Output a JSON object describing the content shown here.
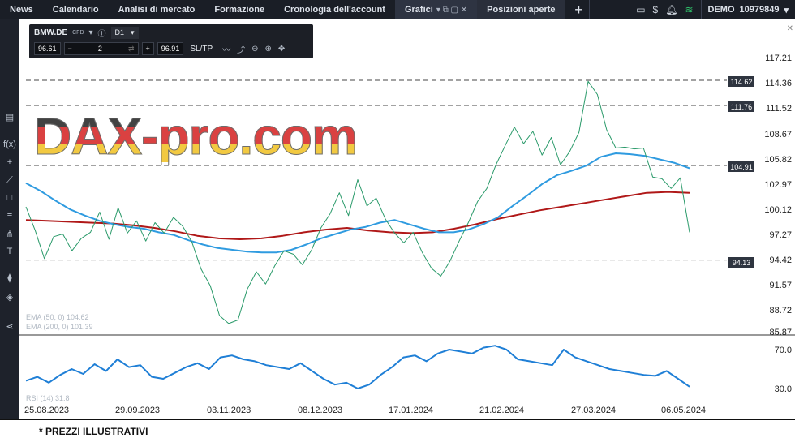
{
  "nav": {
    "tabs": [
      "News",
      "Calendario",
      "Analisi di mercato",
      "Formazione",
      "Cronologia dell'account"
    ],
    "active_tab": "Grafici",
    "active_tab_icons": "▾  ⧉ ▢ ✕",
    "positions_tab": "Posizioni aperte",
    "plus": "+",
    "account_type": "DEMO",
    "account_number": "10979849",
    "account_caret": "▾"
  },
  "sidebar_icons": [
    "layout-icon",
    "fx-icon",
    "crosshair-icon",
    "line-icon",
    "rectangle-icon",
    "fib-icon",
    "pitchfork-icon",
    "text-icon",
    "indicators-icon",
    "layers-icon",
    "share-icon"
  ],
  "widget": {
    "symbol": "BMW.DE",
    "cfd": "CFD",
    "timeframe": "D1",
    "bid": "96.61",
    "qty": "2",
    "ask": "96.91",
    "sltp": "SL/TP",
    "minus": "−",
    "plus": "+"
  },
  "watermark": "DAX-pro.com",
  "price_axis": [
    "117.21",
    "114.36",
    "111.52",
    "108.67",
    "105.82",
    "102.97",
    "100.12",
    "97.27",
    "94.42",
    "91.57",
    "88.72",
    "85.87"
  ],
  "level_tags": [
    "114.62",
    "111.76",
    "104.91",
    "94.13"
  ],
  "rsi_axis": [
    "70.0",
    "30.0"
  ],
  "dates": [
    "25.08.2023",
    "29.09.2023",
    "03.11.2023",
    "08.12.2023",
    "17.01.2024",
    "21.02.2024",
    "27.03.2024",
    "06.05.2024"
  ],
  "legend": {
    "ema50": "EMA (50, 0) 104.62",
    "ema200": "EMA (200, 0) 101.39",
    "rsi": "RSI (14) 31.8"
  },
  "footnote": "* PREZZI ILLUSTRATIVI",
  "colors": {
    "price": "#2a9a6a",
    "ema50": "#2f9be0",
    "ema200": "#b01818",
    "rsi": "#1f7fd6",
    "topbar": "#1a1e26"
  },
  "chart_data": {
    "type": "line",
    "price_close_approx": [
      100.2,
      97.5,
      94.3,
      96.8,
      97.1,
      95.2,
      96.6,
      97.3,
      99.6,
      96.5,
      100.1,
      97.2,
      98.6,
      96.3,
      98.4,
      97.2,
      99.0,
      98.0,
      96.2,
      93.1,
      91.2,
      87.8,
      86.9,
      87.3,
      90.8,
      92.8,
      91.4,
      93.5,
      95.2,
      94.8,
      93.6,
      95.3,
      97.8,
      99.4,
      101.8,
      99.2,
      103.3,
      100.3,
      101.2,
      98.8,
      97.2,
      96.1,
      97.3,
      95.0,
      93.2,
      92.3,
      94.0,
      96.3,
      98.4,
      100.8,
      102.3,
      105.0,
      107.2,
      109.3,
      107.4,
      108.8,
      106.1,
      108.1,
      105.0,
      106.5,
      108.7,
      114.5,
      113.0,
      109.0,
      106.9,
      107.0,
      106.8,
      106.9,
      103.6,
      103.4,
      102.3,
      103.5,
      97.3
    ],
    "ema50_approx": [
      102.9,
      102.0,
      100.9,
      99.9,
      99.2,
      98.6,
      98.2,
      97.9,
      97.7,
      97.3,
      97.0,
      96.4,
      95.9,
      95.5,
      95.3,
      95.1,
      95.0,
      95.0,
      95.3,
      95.9,
      96.6,
      97.1,
      97.6,
      97.9,
      98.4,
      98.7,
      98.2,
      97.7,
      97.3,
      97.3,
      97.6,
      98.2,
      99.0,
      100.3,
      101.5,
      102.8,
      103.8,
      104.3,
      104.9,
      105.9,
      106.3,
      106.2,
      106.0,
      105.6,
      105.2,
      104.6
    ],
    "ema200_approx": [
      98.7,
      98.6,
      98.5,
      98.4,
      98.3,
      98.1,
      97.8,
      97.4,
      96.9,
      96.6,
      96.5,
      96.6,
      96.9,
      97.3,
      97.6,
      97.8,
      97.5,
      97.3,
      97.2,
      97.3,
      97.7,
      98.2,
      98.8,
      99.3,
      99.8,
      100.2,
      100.6,
      101.0,
      101.4,
      101.8,
      101.9,
      101.8
    ],
    "rsi_approx": [
      38,
      42,
      36,
      44,
      50,
      45,
      55,
      48,
      60,
      52,
      54,
      42,
      40,
      46,
      52,
      56,
      50,
      62,
      64,
      60,
      58,
      54,
      52,
      50,
      56,
      48,
      40,
      34,
      36,
      30,
      34,
      44,
      52,
      62,
      64,
      58,
      66,
      70,
      68,
      66,
      72,
      74,
      70,
      60,
      58,
      56,
      54,
      70,
      62,
      58,
      54,
      50,
      48,
      46,
      44,
      43,
      48,
      40,
      31.8
    ],
    "ylim": [
      85.87,
      117.21
    ],
    "rsi_ylim": [
      30,
      70
    ],
    "hlines": [
      114.62,
      111.76,
      104.91,
      94.13
    ]
  }
}
